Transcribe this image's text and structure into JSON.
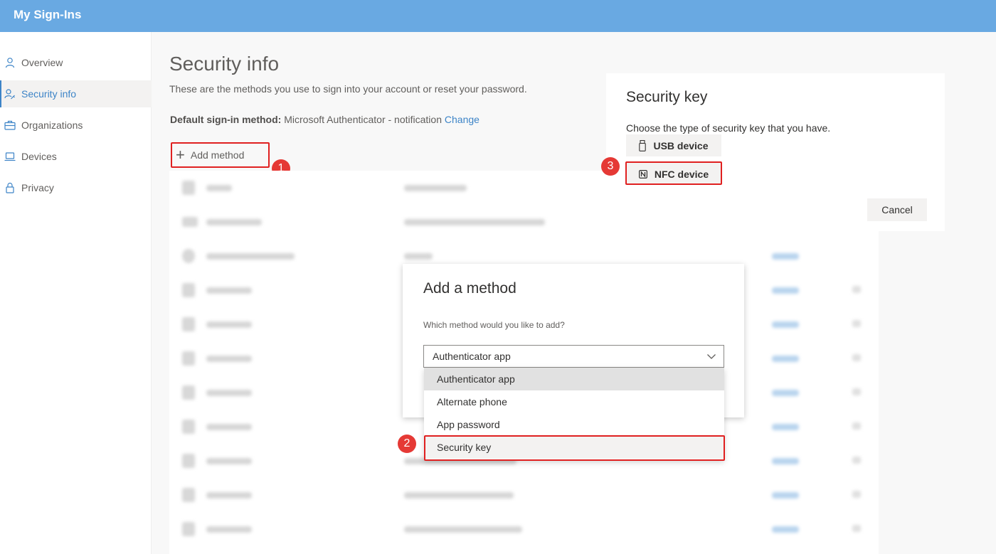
{
  "app": {
    "title": "My Sign-Ins"
  },
  "sidebar": {
    "items": [
      {
        "label": "Overview",
        "icon": "person-icon",
        "active": false
      },
      {
        "label": "Security info",
        "icon": "person-key-icon",
        "active": true
      },
      {
        "label": "Organizations",
        "icon": "briefcase-icon",
        "active": false
      },
      {
        "label": "Devices",
        "icon": "laptop-icon",
        "active": false
      },
      {
        "label": "Privacy",
        "icon": "lock-icon",
        "active": false
      }
    ]
  },
  "page": {
    "title": "Security info",
    "subtitle": "These are the methods you use to sign into your account or reset your password.",
    "default_label": "Default sign-in method:",
    "default_value": " Microsoft Authenticator - notification ",
    "change_link": "Change",
    "add_method_label": "Add method"
  },
  "add_method_dialog": {
    "title": "Add a method",
    "question": "Which method would you like to add?",
    "selected_value": "Authenticator app",
    "options": [
      "Authenticator app",
      "Alternate phone",
      "App password",
      "Security key"
    ]
  },
  "security_key_dialog": {
    "title": "Security key",
    "question": "Choose the type of security key that you have.",
    "usb_label": "USB device",
    "nfc_label": "NFC device",
    "cancel_label": "Cancel"
  },
  "step_badges": [
    "1",
    "2",
    "3"
  ],
  "colors": {
    "header": "#69a9e2",
    "accent": "#3d84c7",
    "highlight_red": "#e02020",
    "badge_red": "#e53935"
  }
}
